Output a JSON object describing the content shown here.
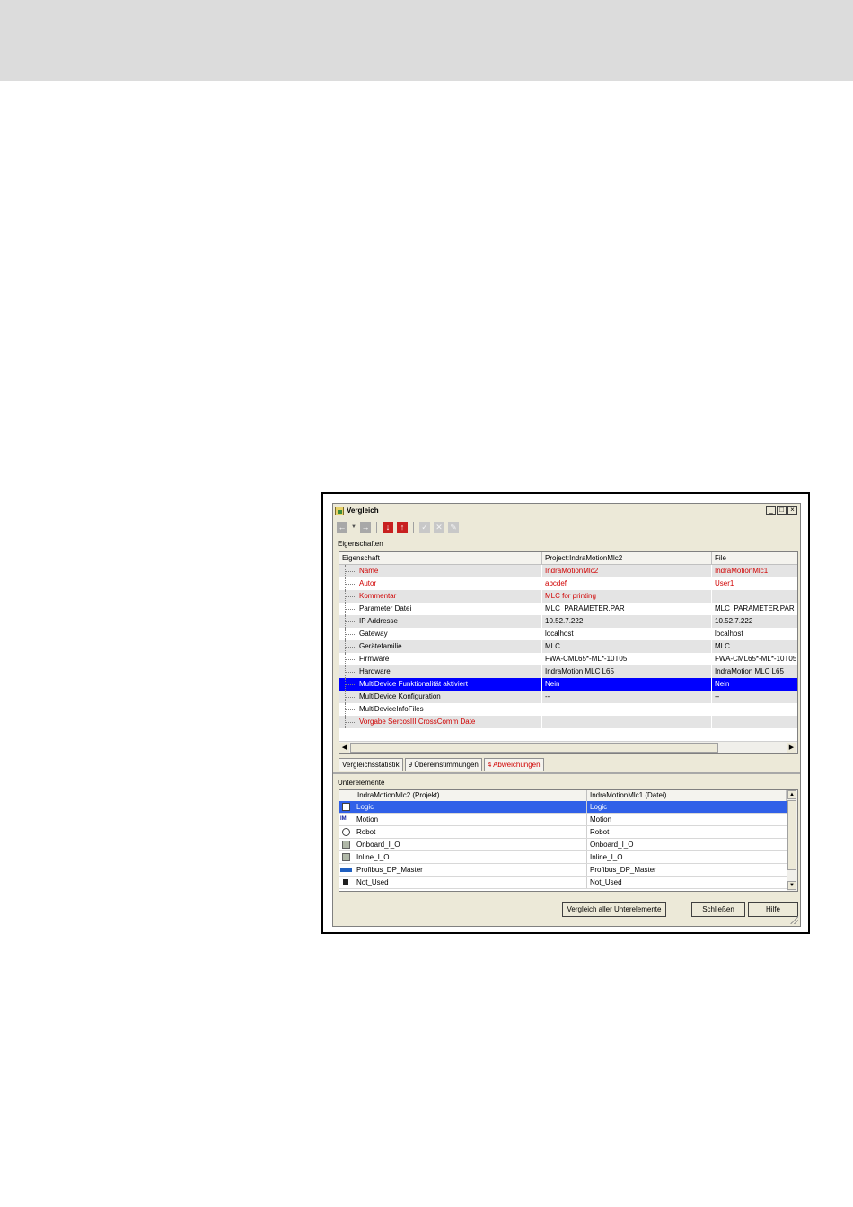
{
  "window": {
    "title": "Vergleich"
  },
  "toolbar": {
    "back_icon": "arrow-left-icon",
    "forward_icon": "arrow-right-icon",
    "next_diff_icon": "arrow-down-icon",
    "prev_diff_icon": "arrow-up-icon",
    "accept_icon": "check-icon",
    "reject_icon": "x-icon",
    "tool_icon": "wrench-icon"
  },
  "properties": {
    "group_label": "Eigenschaften",
    "columns": [
      "Eigenschaft",
      "Project:IndraMotionMlc2",
      "File"
    ],
    "rows": [
      {
        "name": "Name",
        "project": "IndraMotionMlc2",
        "file": "IndraMotionMlc1"
      },
      {
        "name": "Autor",
        "project": "abcdef",
        "file": "User1"
      },
      {
        "name": "Kommentar",
        "project": "MLC for printing",
        "file": ""
      },
      {
        "name": "Parameter Datei",
        "project": "MLC_PARAMETER.PAR",
        "file": "MLC_PARAMETER.PAR"
      },
      {
        "name": "IP Addresse",
        "project": "10.52.7.222",
        "file": "10.52.7.222"
      },
      {
        "name": "Gateway",
        "project": "localhost",
        "file": "localhost"
      },
      {
        "name": "Gerätefamilie",
        "project": "MLC",
        "file": "MLC"
      },
      {
        "name": "Firmware",
        "project": "FWA-CML65*-ML*-10T05",
        "file": "FWA-CML65*-ML*-10T05"
      },
      {
        "name": "Hardware",
        "project": "IndraMotion MLC L65",
        "file": "IndraMotion MLC L65"
      },
      {
        "name": "MultiDevice Funktionalität aktiviert",
        "project": "Nein",
        "file": "Nein"
      },
      {
        "name": "MultiDevice Konfiguration",
        "project": "--",
        "file": "--"
      },
      {
        "name": "MultiDeviceInfoFiles",
        "project": "",
        "file": ""
      },
      {
        "name": "Vorgabe SercosIII CrossComm Date",
        "project": "",
        "file": ""
      }
    ]
  },
  "stats": {
    "label": "Vergleichsstatistik",
    "matches": "9 Übereinstimmungen",
    "differences": "4 Abweichungen",
    "difference_color": "#d00000"
  },
  "subelements": {
    "group_label": "Unterelemente",
    "columns": [
      "IndraMotionMlc2 (Projekt)",
      "IndraMotionMlc1 (Datei)"
    ],
    "rows": [
      {
        "icon": "document-icon",
        "left": "Logic",
        "right": "Logic"
      },
      {
        "icon": "im-icon",
        "left": "Motion",
        "right": "Motion"
      },
      {
        "icon": "magnifier-icon",
        "left": "Robot",
        "right": "Robot"
      },
      {
        "icon": "io-module-icon",
        "left": "Onboard_I_O",
        "right": "Onboard_I_O"
      },
      {
        "icon": "io-module-icon",
        "left": "Inline_I_O",
        "right": "Inline_I_O"
      },
      {
        "icon": "bus-icon",
        "left": "Profibus_DP_Master",
        "right": "Profibus_DP_Master"
      },
      {
        "icon": "black-square-icon",
        "left": "Not_Used",
        "right": "Not_Used"
      }
    ]
  },
  "buttons": {
    "compare_all": "Vergleich aller Unterelemente",
    "close": "Schließen",
    "help": "Hilfe"
  },
  "colors": {
    "selection": "#0000ff",
    "diff_text": "#d00000",
    "top_band": "#dcdcdc"
  }
}
